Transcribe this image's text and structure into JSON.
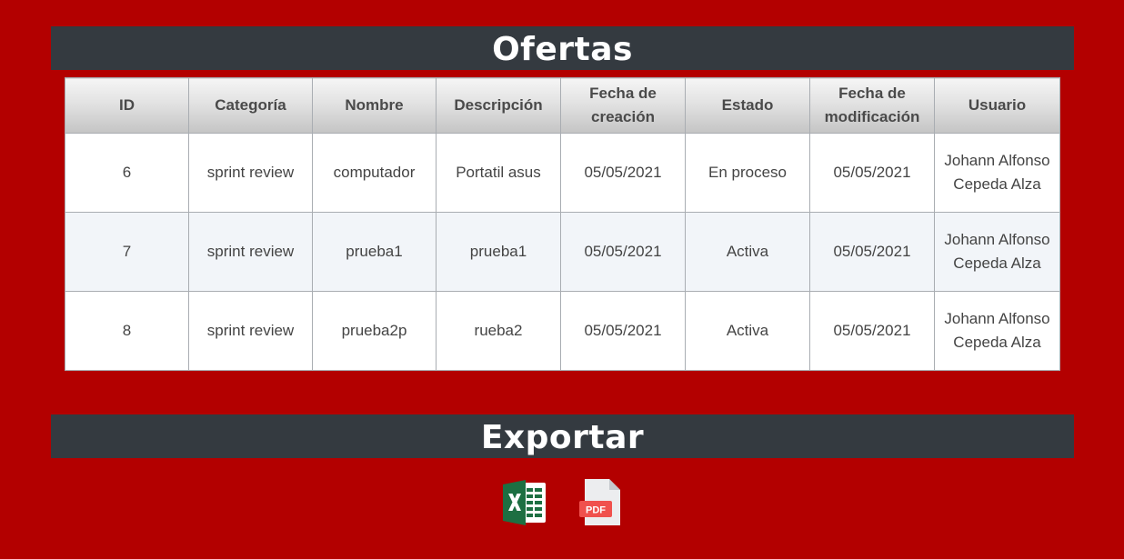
{
  "ofertas": {
    "title": "Ofertas",
    "columns": [
      "ID",
      "Categoría",
      "Nombre",
      "Descripción",
      "Fecha de creación",
      "Estado",
      "Fecha de modificación",
      "Usuario"
    ],
    "rows": [
      {
        "id": "6",
        "categoria": "sprint review",
        "nombre": "computador",
        "descripcion": "Portatil asus",
        "fecha_creacion": "05/05/2021",
        "estado": "En proceso",
        "fecha_modificacion": "05/05/2021",
        "usuario": "Johann Alfonso Cepeda Alza"
      },
      {
        "id": "7",
        "categoria": "sprint review",
        "nombre": "prueba1",
        "descripcion": "prueba1",
        "fecha_creacion": "05/05/2021",
        "estado": "Activa",
        "fecha_modificacion": "05/05/2021",
        "usuario": "Johann Alfonso Cepeda Alza"
      },
      {
        "id": "8",
        "categoria": "sprint review",
        "nombre": "prueba2p",
        "descripcion": "rueba2",
        "fecha_creacion": "05/05/2021",
        "estado": "Activa",
        "fecha_modificacion": "05/05/2021",
        "usuario": "Johann Alfonso Cepeda Alza"
      }
    ]
  },
  "exportar": {
    "title": "Exportar",
    "excel_icon": "excel-icon",
    "pdf_icon": "pdf-icon",
    "pdf_icon_text": "PDF"
  },
  "colors": {
    "page_background": "#b30000",
    "banner_background": "#343a40",
    "excel_green": "#1d6f42",
    "pdf_red": "#f0514d"
  }
}
